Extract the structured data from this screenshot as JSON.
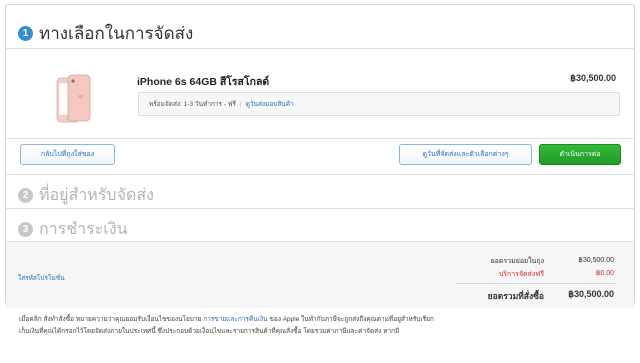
{
  "steps": [
    {
      "number": "1",
      "title": "ทางเลือกในการจัดส่ง"
    },
    {
      "number": "2",
      "title": "ที่อยู่สำหรับจัดส่ง"
    },
    {
      "number": "3",
      "title": "การชำระเงิน"
    }
  ],
  "product": {
    "name": "iPhone 6s 64GB สีโรสโกลด์",
    "price": "฿30,500.00",
    "shipping_info": "พร้อมจัดส่ง: 1-3 วันทำการ - ฟรี",
    "shipping_link": "ดูวันส่งมอบสินค้า",
    "image_icon": "iphone-rose-gold"
  },
  "buttons": {
    "back": "กลับไปที่ถุงใส่ของ",
    "view_dates": "ดูวันที่จัดส่งและตัวเลือกต่างๆ",
    "continue": "ดำเนินการต่อ"
  },
  "promo_link": "ใส่รหัสโปรโมชั่น",
  "summary": {
    "subtotal_label": "ยอดรวมย่อยในถุง",
    "subtotal_value": "฿30,500.00",
    "shipping_label": "บริการจัดส่งฟรี",
    "shipping_value": "฿0.00",
    "total_label": "ยอดรวมที่สั่งซื้อ",
    "total_value": "฿30,500.00"
  },
  "footer": {
    "line1_pre": "เมื่อคลิก สั่งทำสั่งซื้อ หมายความว่าคุณยอมรับเงื่อนไขของนโยบาย",
    "line1_link": "การขายและการคืนเงิน",
    "line1_post": "ของ Apple ในทำกับภาษีจะถูกส่งถึงคุณตามที่อยู่สำหรับเรียก",
    "line2": "เก็บเงินที่คุณได้กรอกไว้โดยจัดส่งภายในประเทศนี้ ซึ่งประกอบด้วยเงื่อนไขและรายการสินค้าที่คุณสั่งซื้อ โดยรวมค่าภาษีและค่าจัดส่ง หากมี"
  },
  "colors": {
    "accent": "#2f8fd0",
    "link": "#2a6fc4",
    "button_green": "#1f9c26",
    "red": "#d42c2c"
  }
}
